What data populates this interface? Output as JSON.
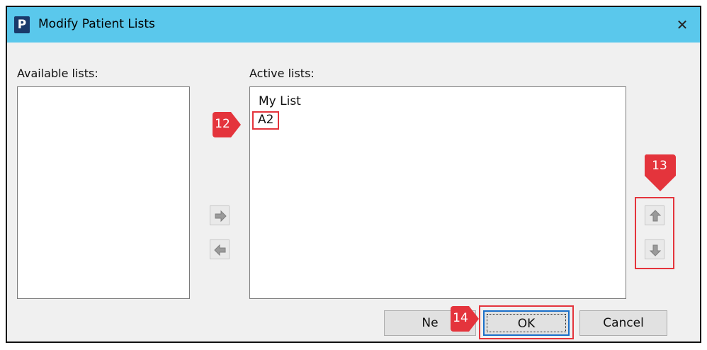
{
  "window": {
    "app_icon": "P",
    "title": "Modify Patient Lists",
    "close_glyph": "✕"
  },
  "available": {
    "label": "Available lists:",
    "items": []
  },
  "active": {
    "label": "Active lists:",
    "items": [
      {
        "label": "My List",
        "highlighted": false
      },
      {
        "label": "A2",
        "highlighted": true
      }
    ]
  },
  "transfer": {
    "add_icon": "arrow-right-icon",
    "remove_icon": "arrow-left-icon"
  },
  "order": {
    "up_icon": "arrow-up-icon",
    "down_icon": "arrow-down-icon"
  },
  "buttons": {
    "new_label": "Ne",
    "ok_label": "OK",
    "cancel_label": "Cancel"
  },
  "callouts": {
    "step12": "12",
    "step13": "13",
    "step14": "14"
  },
  "colors": {
    "titlebar": "#5ac8ec",
    "callout": "#e4343c",
    "focus_border": "#1a6fc9"
  }
}
